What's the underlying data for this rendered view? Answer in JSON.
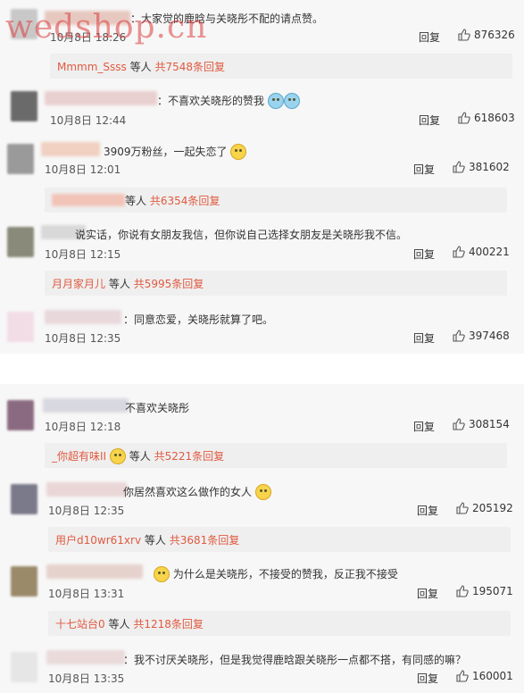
{
  "watermark": "wedshop.cn",
  "colors": {
    "accent_red": "#e05a40",
    "panel_bg": "#f7f7f7",
    "sub_bg": "#efefef"
  },
  "reply_label": "回复",
  "deng": "等人",
  "comments": [
    {
      "text": "：大家觉的鹿晗与关晓彤不配的请点赞。",
      "time": "10月8日 18:26",
      "likes": "876326",
      "sub": {
        "who": "Mmmm_Ssss",
        "count": "共7548条回复"
      }
    },
    {
      "text": "：不喜欢关晓彤的赞我",
      "time": "10月8日 12:44",
      "likes": "618603"
    },
    {
      "text": "3909万粉丝，一起失恋了",
      "time": "10月8日 12:01",
      "likes": "381602",
      "sub": {
        "who": "",
        "count": "共6354条回复"
      }
    },
    {
      "text": "说实话，你说有女朋友我信，但你说自己选择女朋友是关晓彤我不信。",
      "time": "10月8日 12:15",
      "likes": "400221",
      "sub": {
        "who": "月月家月儿",
        "count": "共5995条回复"
      }
    },
    {
      "text": "：同意恋爱，关晓彤就算了吧。",
      "time": "10月8日 12:35",
      "likes": "397468"
    },
    {
      "text": "不喜欢关晓彤",
      "time": "10月8日 12:18",
      "likes": "308154",
      "sub": {
        "who": "_你超有味II",
        "count": "共5221条回复"
      }
    },
    {
      "text": "你居然喜欢这么做作的女人",
      "time": "10月8日 12:35",
      "likes": "205192",
      "sub": {
        "who": "用户d10wr61xrv",
        "count": "共3681条回复"
      }
    },
    {
      "text": "为什么是关晓彤，不接受的赞我，反正我不接受",
      "time": "10月8日 13:31",
      "likes": "195071",
      "sub": {
        "who": "十七站台0",
        "count": "共1218条回复"
      }
    },
    {
      "text": "：我不讨厌关晓彤，但是我觉得鹿晗跟关晓彤一点都不搭，有同感的嘛？",
      "time": "10月8日 13:35",
      "likes": "160001"
    }
  ]
}
